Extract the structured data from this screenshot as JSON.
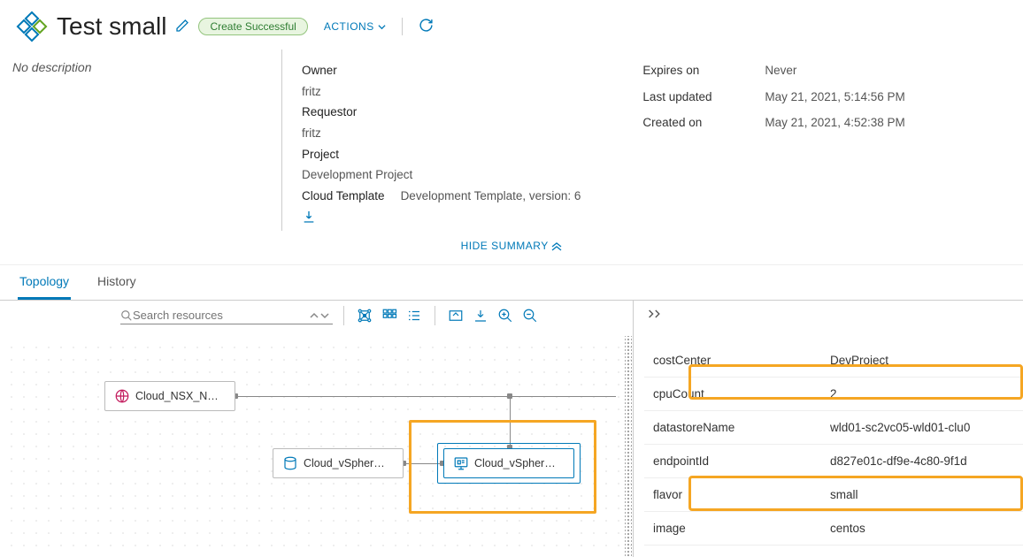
{
  "header": {
    "title": "Test small",
    "badge": "Create Successful",
    "actions_label": "ACTIONS"
  },
  "description": {
    "placeholder": "No description"
  },
  "summary": {
    "owner_label": "Owner",
    "owner_value": "fritz",
    "requestor_label": "Requestor",
    "requestor_value": "fritz",
    "project_label": "Project",
    "project_value": "Development Project",
    "template_label": "Cloud Template",
    "template_value": "Development Template, version: 6",
    "expires_label": "Expires on",
    "expires_value": "Never",
    "updated_label": "Last updated",
    "updated_value": "May 21, 2021, 5:14:56 PM",
    "created_label": "Created on",
    "created_value": "May 21, 2021, 4:52:38 PM"
  },
  "hide_summary_label": "HIDE SUMMARY",
  "tabs": {
    "topology": "Topology",
    "history": "History"
  },
  "search": {
    "placeholder": "Search resources"
  },
  "nodes": {
    "nsx": "Cloud_NSX_N…",
    "disk": "Cloud_vSpher…",
    "machine": "Cloud_vSpher…"
  },
  "props": [
    {
      "key": "costCenter",
      "value": "DevProject"
    },
    {
      "key": "cpuCount",
      "value": "2"
    },
    {
      "key": "datastoreName",
      "value": "wld01-sc2vc05-wld01-clu0"
    },
    {
      "key": "endpointId",
      "value": "d827e01c-df9e-4c80-9f1d"
    },
    {
      "key": "flavor",
      "value": "small"
    },
    {
      "key": "image",
      "value": "centos"
    }
  ]
}
